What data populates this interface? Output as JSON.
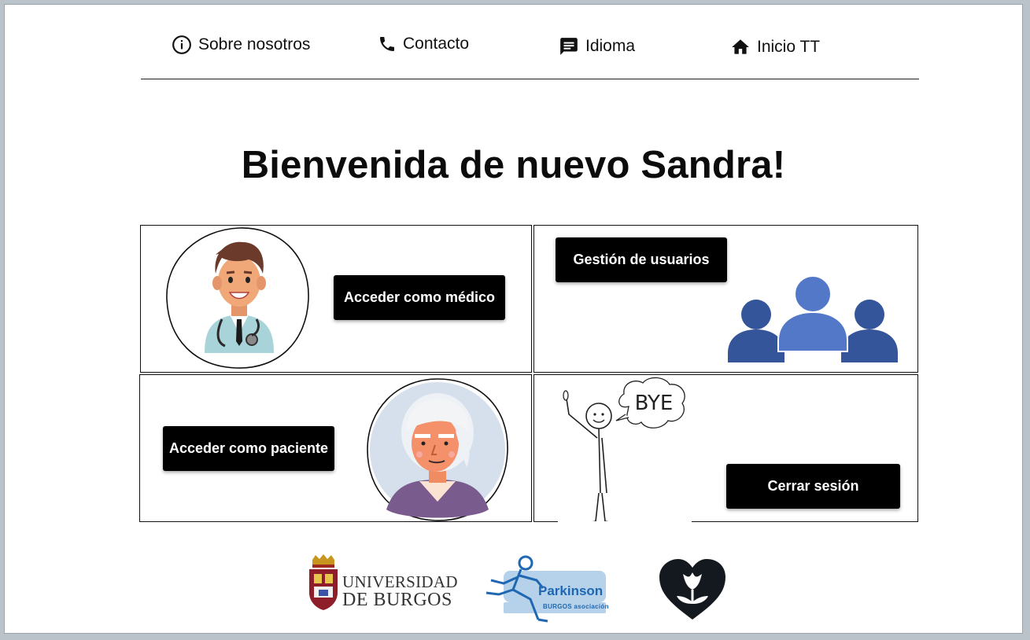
{
  "nav": {
    "about_label": "Sobre nosotros",
    "contact_label": "Contacto",
    "language_label": "Idioma",
    "home_label": "Inicio TT"
  },
  "main": {
    "welcome_title": "Bienvenida de nuevo Sandra!",
    "cards": {
      "doctor_button": "Acceder como médico",
      "users_button": "Gestión de usuarios",
      "patient_button": "Acceder como paciente",
      "logout_button": "Cerrar sesión",
      "bye_text": "BYE"
    }
  },
  "footer": {
    "university_line1": "UNIVERSIDAD",
    "university_line2": "DE BURGOS",
    "parkinson_title": "Parkinson",
    "parkinson_subtitle": "BURGOS asociación"
  },
  "colors": {
    "button_bg": "#000000",
    "users_icon_dark": "#34559a",
    "users_icon_light": "#5278c7",
    "parkinson_blue": "#1f67b1"
  }
}
